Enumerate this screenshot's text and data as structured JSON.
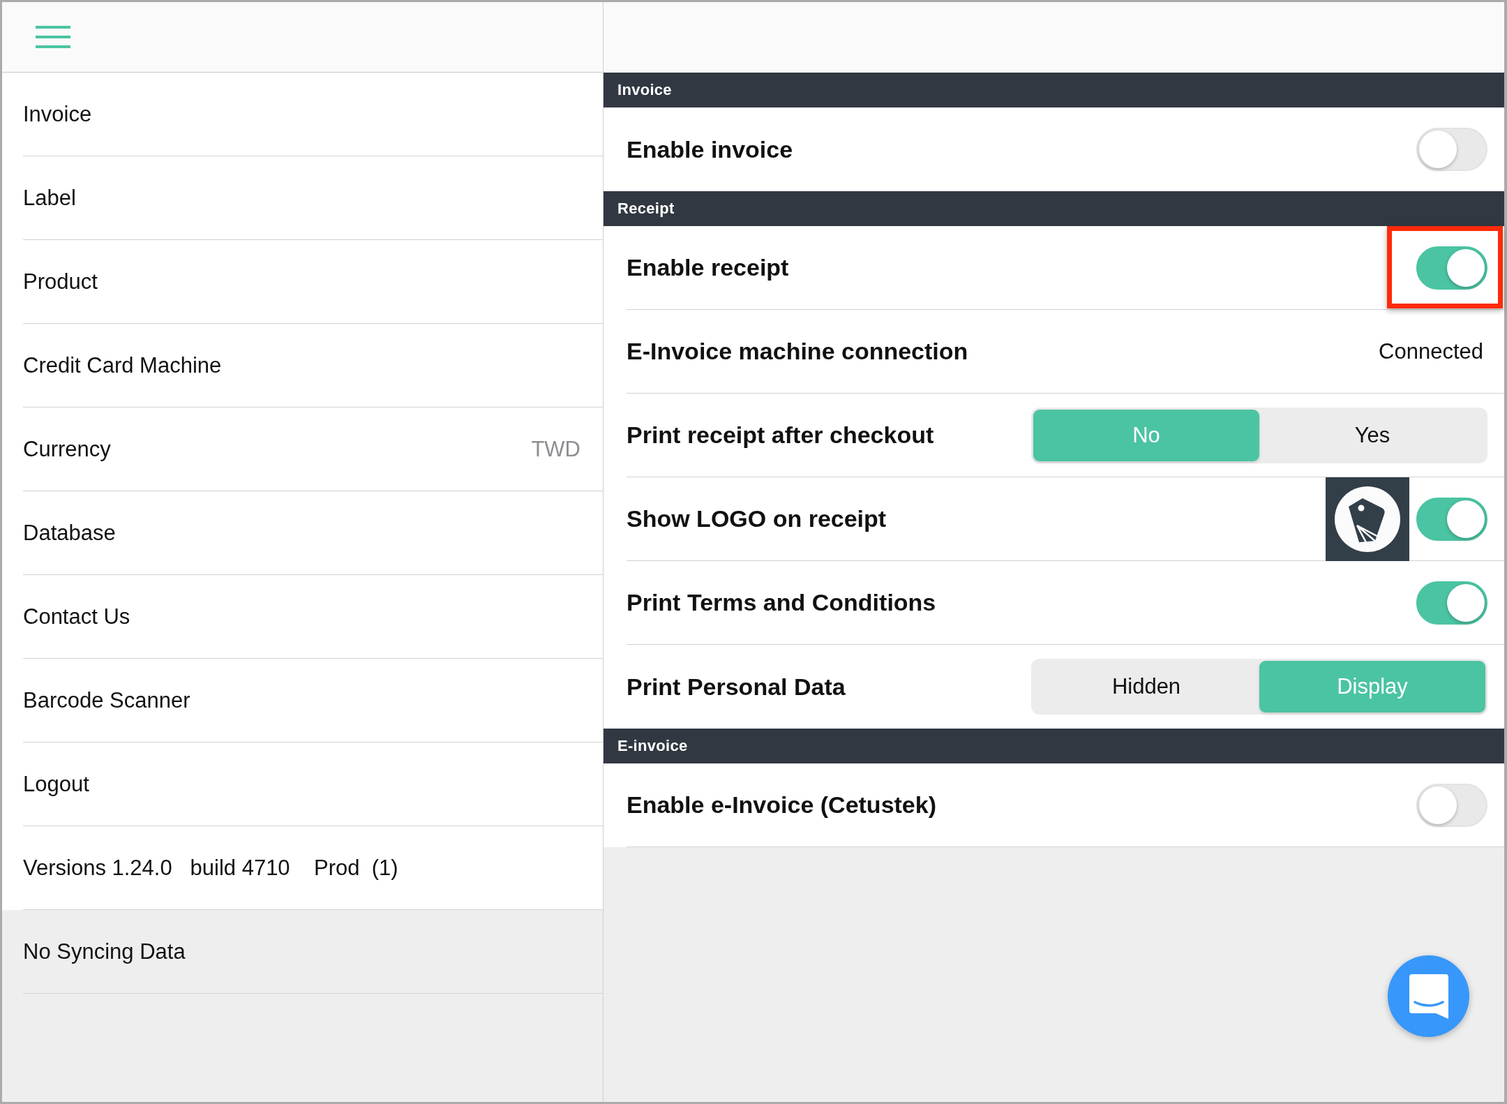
{
  "sidebar": {
    "items": [
      {
        "kind": "item",
        "label": "Invoice"
      },
      {
        "kind": "item",
        "label": "Label"
      },
      {
        "kind": "item",
        "label": "Product"
      },
      {
        "kind": "item",
        "label": "Credit Card Machine"
      },
      {
        "kind": "item",
        "label": "Currency",
        "value": "TWD"
      },
      {
        "kind": "item",
        "label": "Database"
      },
      {
        "kind": "item",
        "label": "Contact Us"
      },
      {
        "kind": "item",
        "label": "Barcode Scanner"
      },
      {
        "kind": "item",
        "label": "Logout"
      },
      {
        "kind": "item",
        "label": "Versions 1.24.0   build 4710    Prod  (1)"
      },
      {
        "kind": "status",
        "label": "No Syncing Data"
      }
    ]
  },
  "settings": {
    "sections": [
      {
        "title": "Invoice",
        "rows": [
          {
            "kind": "toggle",
            "label": "Enable invoice",
            "on": false,
            "highlighted": false
          }
        ]
      },
      {
        "title": "Receipt",
        "rows": [
          {
            "kind": "toggle",
            "label": "Enable receipt",
            "on": true,
            "highlighted": true
          },
          {
            "kind": "value",
            "label": "E-Invoice machine connection",
            "value": "Connected"
          },
          {
            "kind": "segmented",
            "label": "Print receipt after checkout",
            "options": [
              {
                "label": "No",
                "selected": true
              },
              {
                "label": "Yes",
                "selected": false
              }
            ]
          },
          {
            "kind": "logo_toggle",
            "label": "Show LOGO on receipt",
            "on": true,
            "highlighted": false
          },
          {
            "kind": "toggle",
            "label": "Print Terms and Conditions",
            "on": true,
            "highlighted": false
          },
          {
            "kind": "segmented",
            "label": "Print Personal Data",
            "options": [
              {
                "label": "Hidden",
                "selected": false
              },
              {
                "label": "Display",
                "selected": true
              }
            ]
          }
        ]
      },
      {
        "title": "E-invoice",
        "rows": [
          {
            "kind": "toggle",
            "label": "Enable e-Invoice (Cetustek)",
            "on": false,
            "highlighted": false
          }
        ]
      }
    ]
  }
}
